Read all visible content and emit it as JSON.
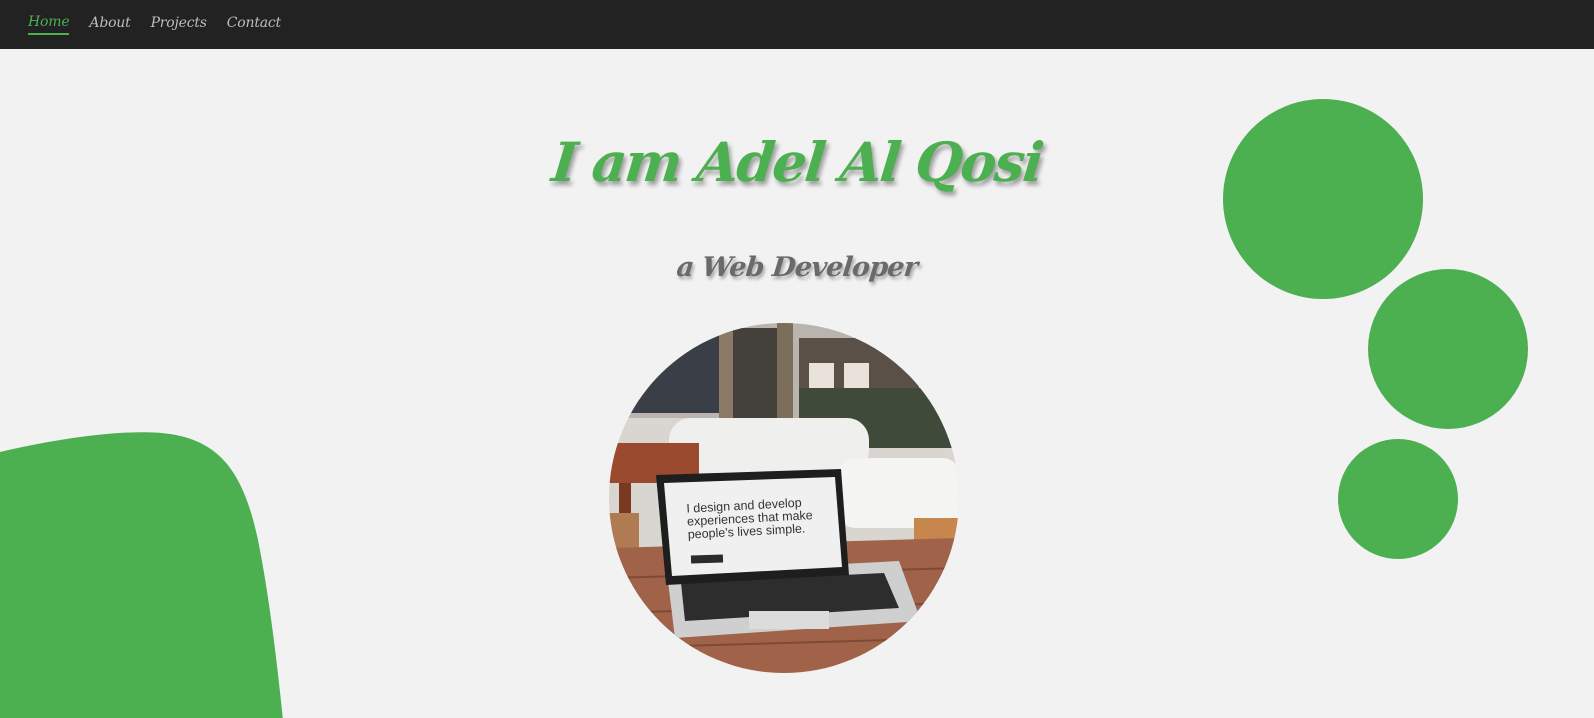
{
  "nav": {
    "items": [
      {
        "label": "Home",
        "active": true
      },
      {
        "label": "About",
        "active": false
      },
      {
        "label": "Projects",
        "active": false
      },
      {
        "label": "Contact",
        "active": false
      }
    ]
  },
  "hero": {
    "title": "I am Adel Al Qosi",
    "subtitle": "a Web Developer",
    "photo": {
      "laptop_screen_text": "I design and develop experiences that make people's lives simple."
    }
  },
  "colors": {
    "accent": "#4caf50",
    "navbar_bg": "#222222",
    "page_bg": "#f2f2f2",
    "nav_text": "#bdbdbd",
    "subtitle_text": "#6a6a6a"
  }
}
